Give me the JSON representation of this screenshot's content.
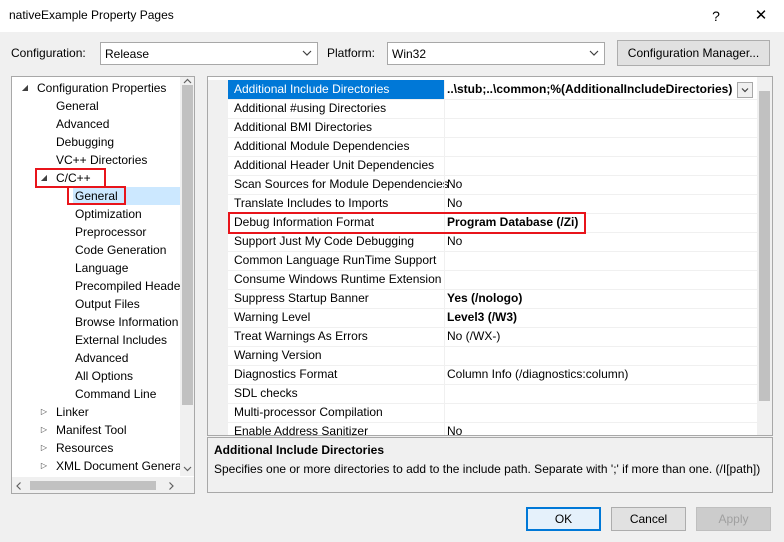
{
  "window": {
    "title": "nativeExample Property Pages",
    "help_glyph": "?",
    "close_glyph": "✕"
  },
  "toolbar": {
    "configuration_label": "Configuration:",
    "configuration_value": "Release",
    "platform_label": "Platform:",
    "platform_value": "Win32",
    "configuration_manager_label": "Configuration Manager..."
  },
  "tree": {
    "items": [
      {
        "label": "Configuration Properties",
        "expander": "open"
      },
      {
        "label": "General"
      },
      {
        "label": "Advanced"
      },
      {
        "label": "Debugging"
      },
      {
        "label": "VC++ Directories"
      },
      {
        "label": "C/C++",
        "expander": "open"
      },
      {
        "label": "General",
        "selected": true
      },
      {
        "label": "Optimization"
      },
      {
        "label": "Preprocessor"
      },
      {
        "label": "Code Generation"
      },
      {
        "label": "Language"
      },
      {
        "label": "Precompiled Heade"
      },
      {
        "label": "Output Files"
      },
      {
        "label": "Browse Information"
      },
      {
        "label": "External Includes"
      },
      {
        "label": "Advanced"
      },
      {
        "label": "All Options"
      },
      {
        "label": "Command Line"
      },
      {
        "label": "Linker",
        "expander": "closed"
      },
      {
        "label": "Manifest Tool",
        "expander": "closed"
      },
      {
        "label": "Resources",
        "expander": "closed"
      },
      {
        "label": "XML Document Genera",
        "expander": "closed"
      }
    ]
  },
  "grid": {
    "rows": [
      {
        "name": "Additional Include Directories",
        "value": "..\\stub;..\\common;%(AdditionalIncludeDirectories)",
        "bold": true,
        "selected": true
      },
      {
        "name": "Additional #using Directories",
        "value": ""
      },
      {
        "name": "Additional BMI Directories",
        "value": ""
      },
      {
        "name": "Additional Module Dependencies",
        "value": ""
      },
      {
        "name": "Additional Header Unit Dependencies",
        "value": ""
      },
      {
        "name": "Scan Sources for Module Dependencies",
        "value": "No"
      },
      {
        "name": "Translate Includes to Imports",
        "value": "No"
      },
      {
        "name": "Debug Information Format",
        "value": "Program Database (/Zi)",
        "bold": true
      },
      {
        "name": "Support Just My Code Debugging",
        "value": "No"
      },
      {
        "name": "Common Language RunTime Support",
        "value": ""
      },
      {
        "name": "Consume Windows Runtime Extension",
        "value": ""
      },
      {
        "name": "Suppress Startup Banner",
        "value": "Yes (/nologo)",
        "bold": true
      },
      {
        "name": "Warning Level",
        "value": "Level3 (/W3)",
        "bold": true
      },
      {
        "name": "Treat Warnings As Errors",
        "value": "No (/WX-)"
      },
      {
        "name": "Warning Version",
        "value": ""
      },
      {
        "name": "Diagnostics Format",
        "value": "Column Info (/diagnostics:column)"
      },
      {
        "name": "SDL checks",
        "value": ""
      },
      {
        "name": "Multi-processor Compilation",
        "value": ""
      },
      {
        "name": "Enable Address Sanitizer",
        "value": "No"
      }
    ]
  },
  "description": {
    "title": "Additional Include Directories",
    "body": "Specifies one or more directories to add to the include path. Separate with ';' if more than one. (/I[path])"
  },
  "footer": {
    "ok_label": "OK",
    "cancel_label": "Cancel",
    "apply_label": "Apply"
  },
  "colors": {
    "highlight": "#e8141b",
    "selection": "#0078d7",
    "tree_selection": "#cce8ff"
  }
}
